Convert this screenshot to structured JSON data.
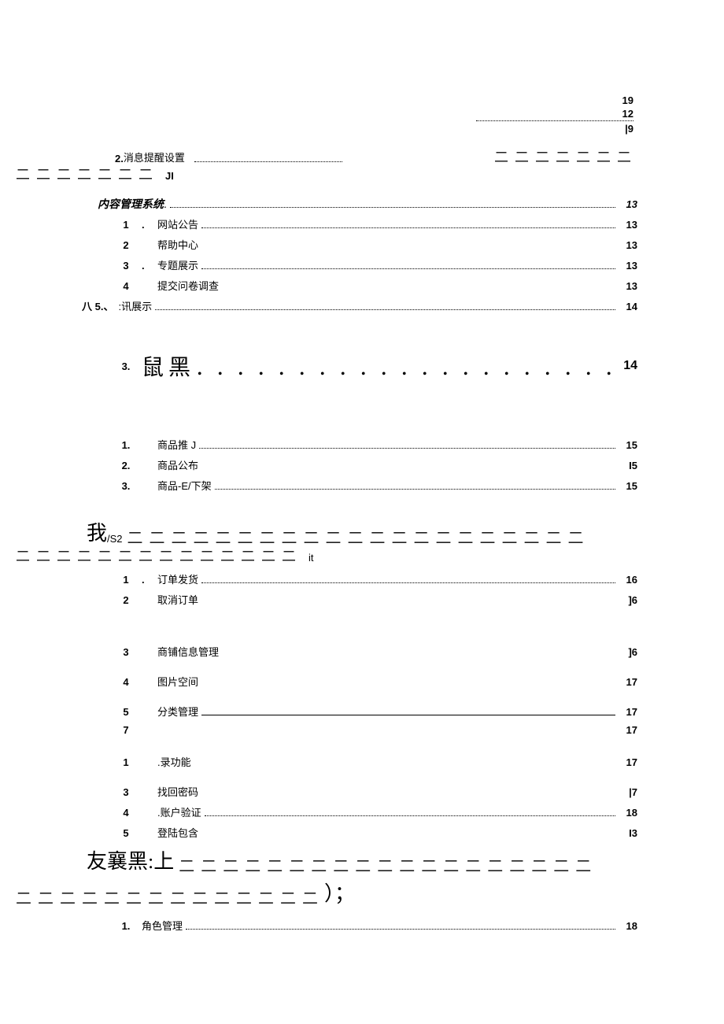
{
  "topRight": {
    "l1": "19",
    "l2": "12",
    "l3": "|9"
  },
  "dashSeg7": "二 二 二 二 二 二 二",
  "row_msg": {
    "num": "2.",
    "label": "消息提醒设置"
  },
  "suffix_JI": "JI",
  "row_cms": {
    "label": "内容管理系统",
    "page": "13"
  },
  "rows1": [
    {
      "num": "1",
      "sep": ".",
      "label": "网站公告",
      "page": "13",
      "dots": true
    },
    {
      "num": "2",
      "sep": "",
      "label": "帮助中心",
      "page": "13",
      "dots": false
    },
    {
      "num": "3",
      "sep": ".",
      "label": "专题展示",
      "page": "13",
      "dots": true
    },
    {
      "num": "4",
      "sep": "",
      "label": "提交问卷调查",
      "page": "13",
      "dots": false
    }
  ],
  "row_xun": {
    "num": "八 5.、",
    "label": ":讯展示",
    "page": "14"
  },
  "row_shu": {
    "num": "3.",
    "label": "鼠黑",
    "page": "14"
  },
  "rows2": [
    {
      "num": "1.",
      "label": "商品推 J",
      "page": "15",
      "dots": true
    },
    {
      "num": "2.",
      "label": "商品公布",
      "page": "I5",
      "dots": false
    },
    {
      "num": "3.",
      "label": "商品-E/下架",
      "page": "15",
      "dots": true
    }
  ],
  "row_wo": {
    "prefix": "我",
    "sub": "/S2"
  },
  "suffix_it": "it",
  "rows3": [
    {
      "num": "1",
      "sep": ".",
      "label": "订单发货",
      "page": "16",
      "dots": true
    },
    {
      "num": "2",
      "sep": "",
      "label": "取消订单",
      "page": "]6",
      "dots": false
    }
  ],
  "rows4": [
    {
      "num": "3",
      "label": "商铺信息管理",
      "page": "]6",
      "dots": false
    },
    {
      "num": "4",
      "label": "图片空间",
      "page": "17",
      "dots": false
    },
    {
      "num": "5",
      "label": "分类管理",
      "page": "17",
      "underline": true
    },
    {
      "num": "7",
      "label": "",
      "page": "17",
      "dots": false
    },
    {
      "num": "1",
      "label": ".录功能",
      "page": "17",
      "dots": false
    },
    {
      "num": "3",
      "label": "找回密码",
      "page": "|7",
      "dots": false
    },
    {
      "num": "4",
      "label": ".账户验证",
      "page": "18",
      "dots": true
    },
    {
      "num": "5",
      "label": "登陆包含",
      "page": "I3",
      "dots": false
    }
  ],
  "row_you": {
    "label": "友襄黑:上",
    "suffix": "）；"
  },
  "row_role": {
    "num": "1.",
    "label": "角色管理",
    "page": "18"
  }
}
